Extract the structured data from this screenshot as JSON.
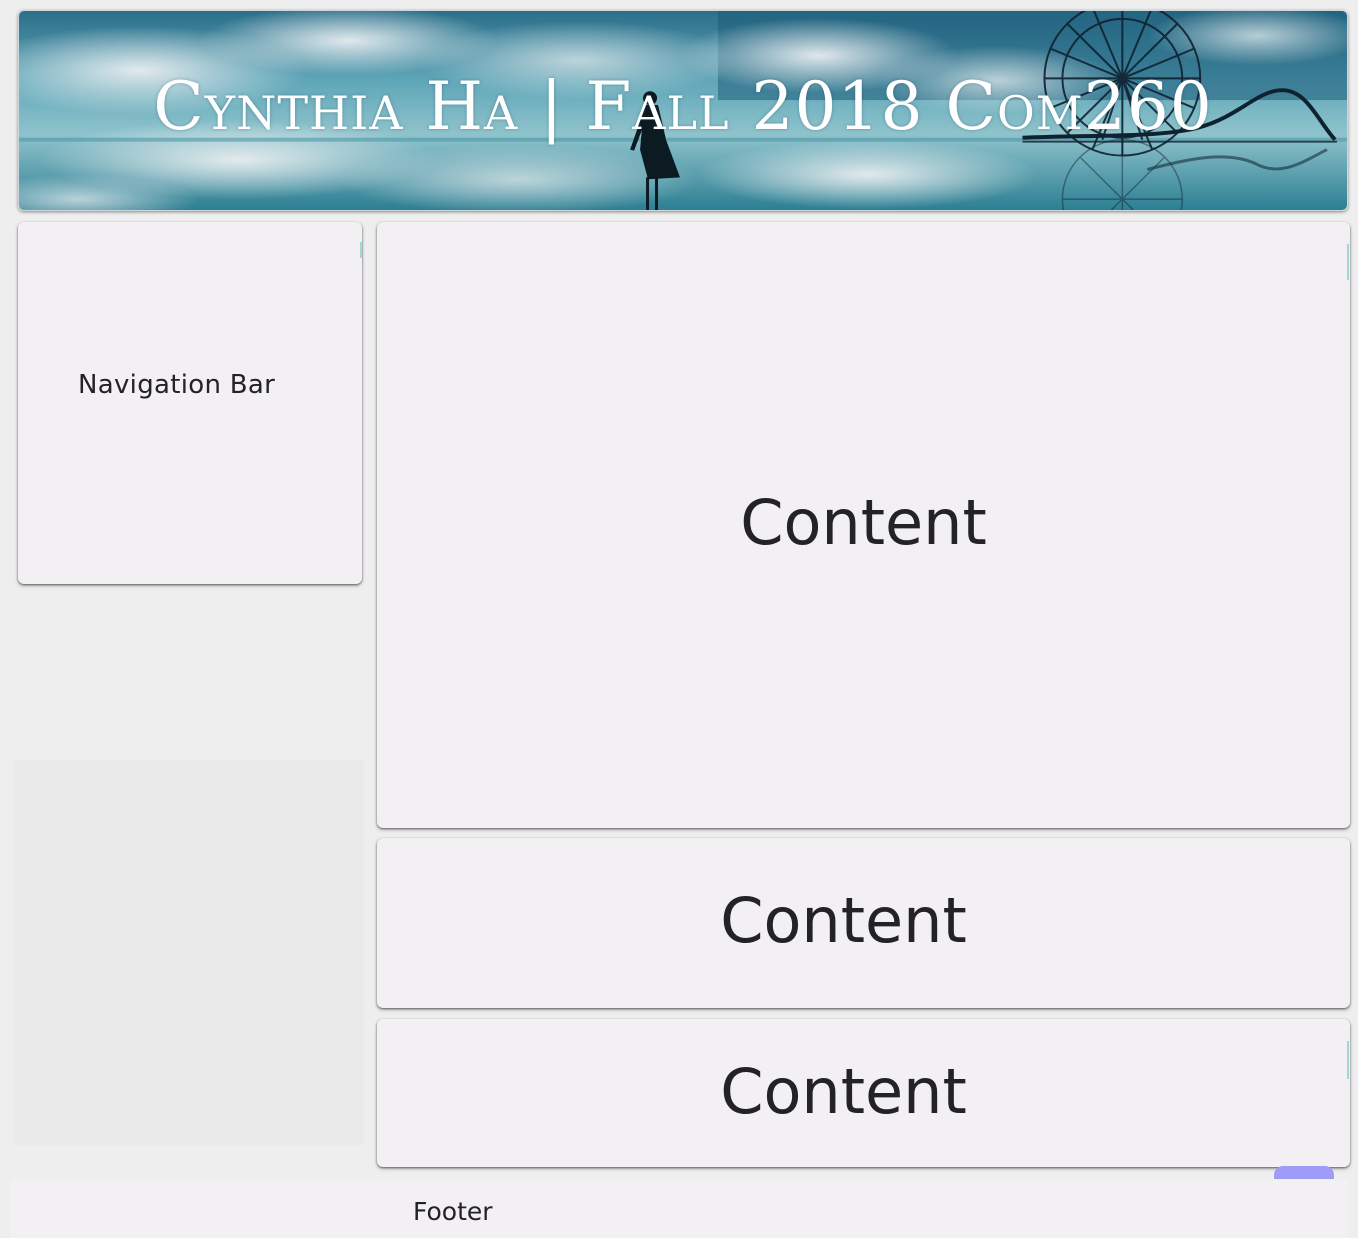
{
  "header": {
    "title": "Cynthia Ha | Fall 2018 Com260"
  },
  "navigation": {
    "label": "Navigation Bar"
  },
  "content_blocks": [
    {
      "label": "Content"
    },
    {
      "label": "Content"
    },
    {
      "label": "Content"
    }
  ],
  "footer": {
    "label": "Footer"
  },
  "colors": {
    "background": "#efeeef",
    "panel": "#f2f0f3",
    "text": "#232225",
    "scroll_button": "#9f9cf8",
    "banner_sky": "#2a7f95"
  }
}
